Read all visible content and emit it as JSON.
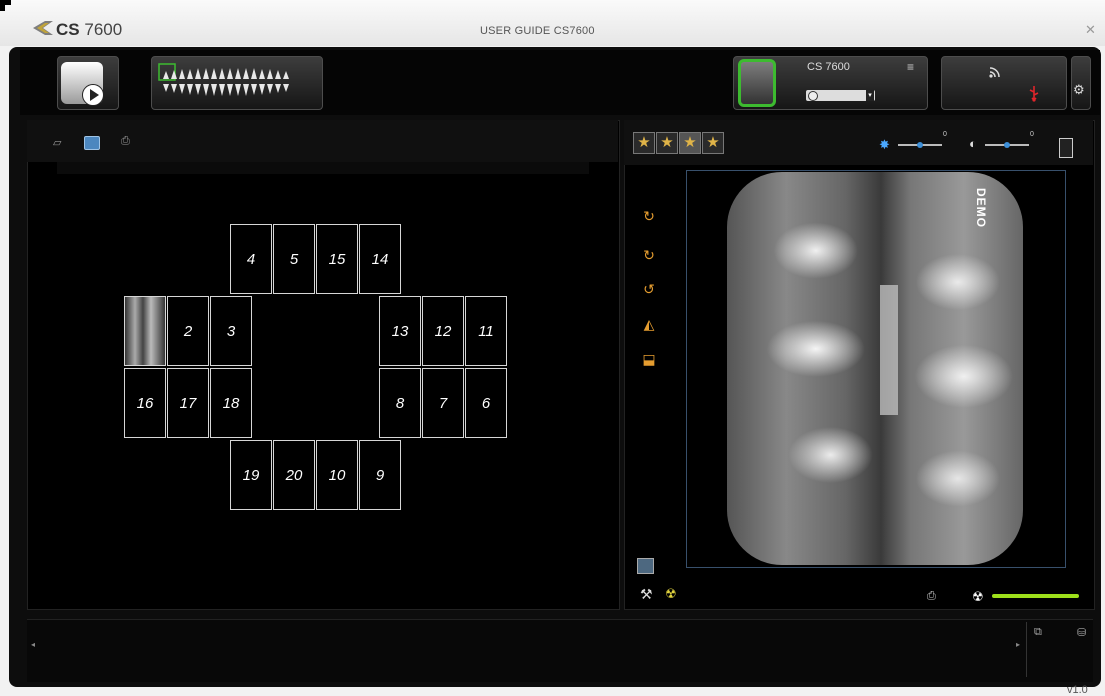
{
  "title_bar": {
    "brand": "CS",
    "model": "7600",
    "guide_title": "USER GUIDE CS7600",
    "close_glyph": "✕"
  },
  "toolbar": {
    "demo_button_icon": "demo-tooth-play-icon",
    "teeth_selector_icon": "dental-chart-teeth-icon",
    "device": {
      "name": "CS 7600",
      "menu_glyph": "≡",
      "select_arrow": "▾"
    },
    "wifi_icon": "wifi-icon",
    "usb_icon": "usb-icon",
    "settings_icon": "gear-icon",
    "accent_color": "#3dbb30"
  },
  "left_panel": {
    "view_icons": [
      "single-image-icon",
      "grid-view-icon",
      "capture-icon"
    ],
    "tooth_slots": {
      "top_row": [
        "4",
        "5",
        "15",
        "14"
      ],
      "upper_left": [
        "2",
        "3"
      ],
      "upper_right": [
        "13",
        "12",
        "11"
      ],
      "lower_left": [
        "16",
        "17",
        "18"
      ],
      "lower_right": [
        "8",
        "7",
        "6"
      ],
      "bottom_row": [
        "19",
        "20",
        "10",
        "9"
      ]
    }
  },
  "right_panel": {
    "rating_stars": [
      "1",
      "2",
      "3",
      "4"
    ],
    "brightness_value": "0",
    "contrast_value": "0",
    "tools": [
      "rotate-90-icon",
      "rotate-180-icon",
      "rotate-270-icon",
      "flip-horizontal-icon",
      "flip-vertical-icon"
    ],
    "xray_watermark": "DEMO",
    "dose_bar_color": "#9ee01b"
  },
  "footer": {
    "version": "v1.0"
  }
}
